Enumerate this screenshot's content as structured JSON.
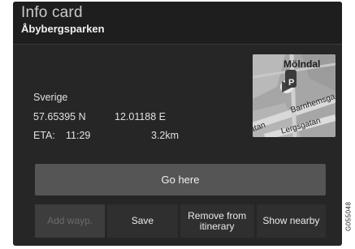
{
  "header": {
    "title": "Info card",
    "subtitle": "Åbybergsparken"
  },
  "location": {
    "country": "Sverige",
    "latitude": "57.65395 N",
    "longitude": "12.01188 E",
    "eta_label": "ETA:",
    "eta_time": "11:29",
    "distance": "3.2km"
  },
  "map": {
    "labels": [
      "Mölndal",
      "Barnhemsga",
      "atan",
      "Lergsgatan"
    ]
  },
  "actions": {
    "go_here": "Go here",
    "add_waypoint": "Add wayp.",
    "save": "Save",
    "remove_line1": "Remove from",
    "remove_line2": "itinerary",
    "show_nearby": "Show nearby"
  },
  "figure_code": "G055048"
}
